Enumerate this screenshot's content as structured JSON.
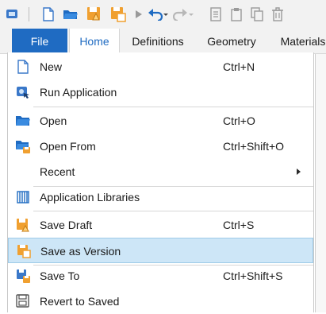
{
  "ribbon": {
    "tabs": [
      {
        "label": "File"
      },
      {
        "label": "Home"
      },
      {
        "label": "Definitions"
      },
      {
        "label": "Geometry"
      },
      {
        "label": "Materials"
      }
    ]
  },
  "quick_access_toolbar": {
    "icons": [
      "app-icon",
      "new-file-icon",
      "open-folder-icon",
      "save-draft-icon",
      "save-version-icon",
      "run-icon",
      "undo-icon",
      "redo-icon",
      "copy-icon",
      "paste-icon",
      "duplicate-icon",
      "delete-icon"
    ]
  },
  "file_menu": {
    "items": [
      {
        "label": "New",
        "shortcut": "Ctrl+N",
        "icon": "new-file-icon"
      },
      {
        "label": "Run Application",
        "shortcut": "",
        "icon": "run-application-icon"
      },
      {
        "label": "Open",
        "shortcut": "Ctrl+O",
        "icon": "open-folder-icon"
      },
      {
        "label": "Open From",
        "shortcut": "Ctrl+Shift+O",
        "icon": "open-from-icon"
      },
      {
        "label": "Recent",
        "shortcut": "",
        "icon": "",
        "submenu": true
      },
      {
        "label": "Application Libraries",
        "shortcut": "",
        "icon": "application-libraries-icon"
      },
      {
        "label": "Save Draft",
        "shortcut": "Ctrl+S",
        "icon": "save-draft-icon"
      },
      {
        "label": "Save as Version",
        "shortcut": "",
        "icon": "save-as-version-icon",
        "highlighted": true
      },
      {
        "label": "Save To",
        "shortcut": "Ctrl+Shift+S",
        "icon": "save-to-icon"
      },
      {
        "label": "Revert to Saved",
        "shortcut": "",
        "icon": "revert-icon"
      }
    ]
  },
  "colors": {
    "accent": "#1f6bc2",
    "highlight": "#cde6f7",
    "icon_orange": "#f0a030"
  }
}
